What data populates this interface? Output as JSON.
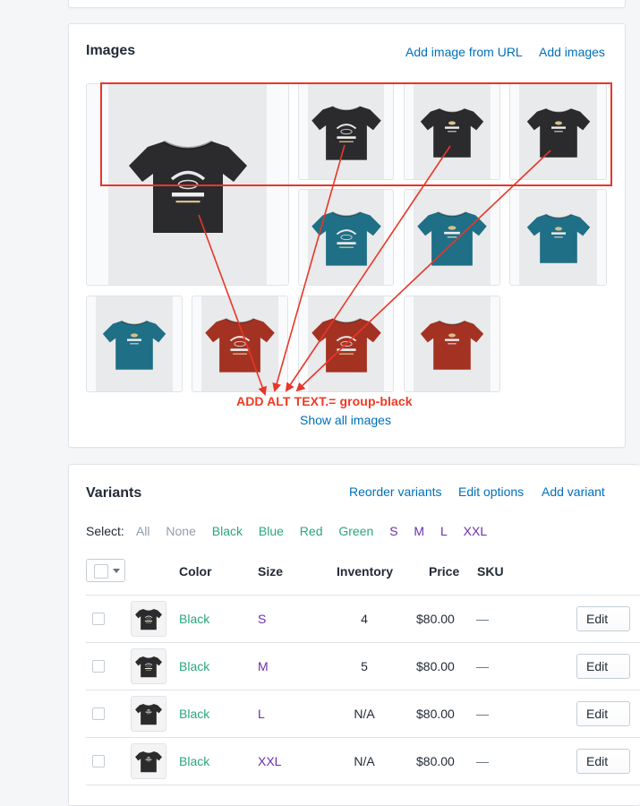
{
  "images_card": {
    "title": "Images",
    "add_from_url": "Add image from URL",
    "add_images": "Add images",
    "show_all": "Show all images",
    "annotation": "ADD ALT  TEXT.= group-black",
    "annotation_color": "#ee3a24"
  },
  "images": [
    {
      "shirt": "#2b2b2d",
      "design": "JUST RIDE CAFE RACER"
    },
    {
      "shirt": "#2b2b2d",
      "design": "JUST RIDE CAFE RACER"
    },
    {
      "shirt": "#2b2b2d",
      "design": "T-SHIRT BACK"
    },
    {
      "shirt": "#2b2b2d",
      "design": "T-SHIRT BACK"
    },
    {
      "shirt": "#1f6f86",
      "design": "JUST RIDE CAFE RACER"
    },
    {
      "shirt": "#1f6f86",
      "design": "T-SHIRT BACK"
    },
    {
      "shirt": "#1f6f86",
      "design": "T-SHIRT BACK"
    },
    {
      "shirt": "#1f6f86",
      "design": "T-SHIRT BACK"
    },
    {
      "shirt": "#a33222",
      "design": "JUST RIDE CAFE RACER"
    },
    {
      "shirt": "#a33222",
      "design": "JUST RIDE CAFE RACER"
    },
    {
      "shirt": "#a33222",
      "design": "T-SHIRT BACK"
    }
  ],
  "variants_card": {
    "title": "Variants",
    "reorder": "Reorder variants",
    "edit_options": "Edit options",
    "add_variant": "Add variant"
  },
  "select": {
    "label": "Select:",
    "all": "All",
    "none": "None",
    "black": "Black",
    "blue": "Blue",
    "red": "Red",
    "green": "Green",
    "s": "S",
    "m": "M",
    "l": "L",
    "xxl": "XXL"
  },
  "table": {
    "headers": {
      "color": "Color",
      "size": "Size",
      "inventory": "Inventory",
      "price": "Price",
      "sku": "SKU"
    },
    "rows": [
      {
        "color": "Black",
        "size": "S",
        "inventory": "4",
        "price": "$80.00",
        "sku": "—",
        "edit": "Edit"
      },
      {
        "color": "Black",
        "size": "M",
        "inventory": "5",
        "price": "$80.00",
        "sku": "—",
        "edit": "Edit"
      },
      {
        "color": "Black",
        "size": "L",
        "inventory": "N/A",
        "price": "$80.00",
        "sku": "—",
        "edit": "Edit"
      },
      {
        "color": "Black",
        "size": "XXL",
        "inventory": "N/A",
        "price": "$80.00",
        "sku": "—",
        "edit": "Edit"
      }
    ]
  },
  "colors": {
    "link": "#006fbb",
    "green_value": "#2aa67f",
    "purple_value": "#6b2fa9"
  }
}
